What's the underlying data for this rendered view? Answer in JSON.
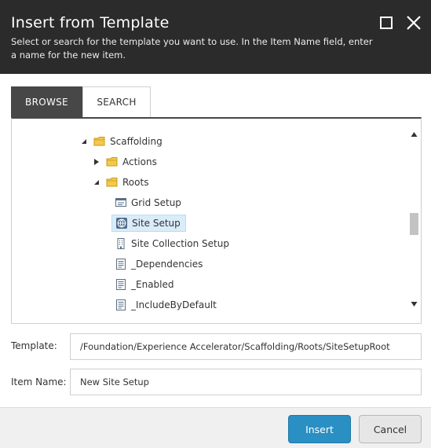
{
  "dialog": {
    "title": "Insert from Template",
    "subtitle": "Select or search for the template you want to use. In the Item Name field, enter a name for the new item."
  },
  "tabs": [
    {
      "label": "BROWSE",
      "active": true
    },
    {
      "label": "SEARCH",
      "active": false
    }
  ],
  "tree": {
    "items": [
      {
        "label": "Scaffolding",
        "icon": "folder-icon",
        "expanded": true
      },
      {
        "label": "Actions",
        "icon": "folder-icon",
        "expanded": false
      },
      {
        "label": "Roots",
        "icon": "folder-icon",
        "expanded": true
      },
      {
        "label": "Grid Setup",
        "icon": "grid-setup-icon"
      },
      {
        "label": "Site Setup",
        "icon": "globe-icon",
        "selected": true
      },
      {
        "label": "Site Collection Setup",
        "icon": "building-icon"
      },
      {
        "label": "_Dependencies",
        "icon": "document-icon"
      },
      {
        "label": "_Enabled",
        "icon": "document-icon"
      },
      {
        "label": "_IncludeByDefault",
        "icon": "document-icon"
      }
    ]
  },
  "form": {
    "template_label": "Template:",
    "template_value": "/Foundation/Experience Accelerator/Scaffolding/Roots/SiteSetupRoot",
    "item_name_label": "Item Name:",
    "item_name_value": "New Site Setup"
  },
  "buttons": {
    "insert": "Insert",
    "cancel": "Cancel"
  },
  "colors": {
    "titlebar": "#2b2b2b",
    "active_tab": "#474747",
    "primary_button": "#2a8fc3",
    "selection": "#d9ecf8",
    "folder": "#f3c94b"
  }
}
